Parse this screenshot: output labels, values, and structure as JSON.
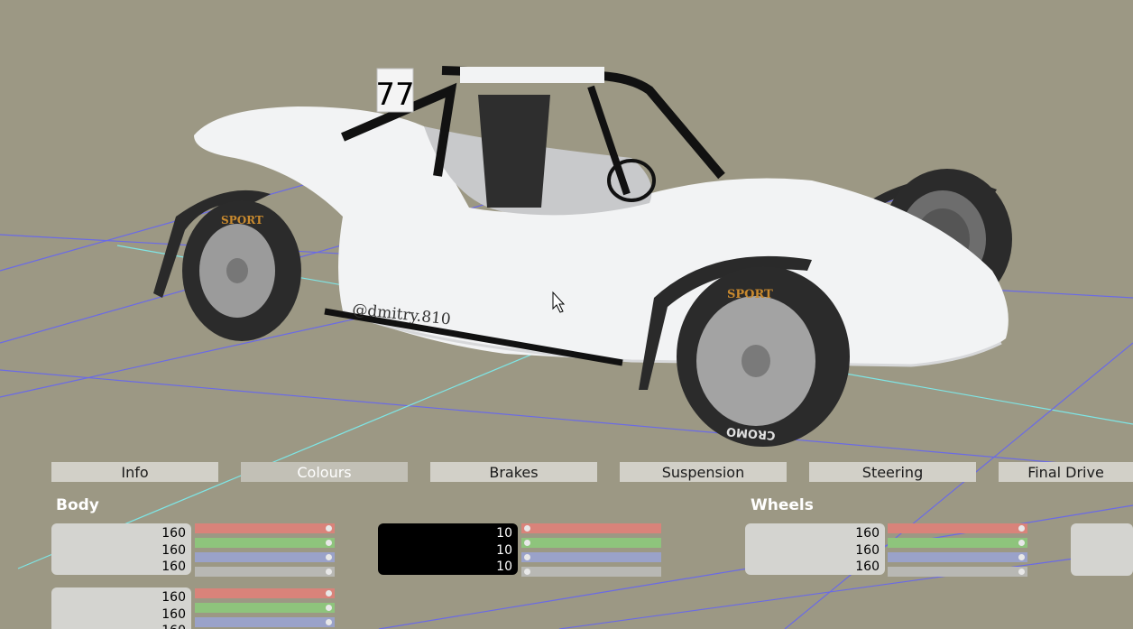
{
  "tabs": [
    {
      "label": "Info"
    },
    {
      "label": "Colours"
    },
    {
      "label": "Brakes"
    },
    {
      "label": "Suspension"
    },
    {
      "label": "Steering"
    },
    {
      "label": "Final Drive"
    }
  ],
  "active_tab": "Colours",
  "car": {
    "number": "77",
    "side_text": "@dmitry.810",
    "tyre_brand": "SPORT",
    "rim_brand": "CROMO"
  },
  "sections": {
    "body": {
      "label": "Body",
      "primary": [
        "160",
        "160",
        "160"
      ],
      "secondary": [
        "10",
        "10",
        "10"
      ],
      "tertiary": [
        "160",
        "160",
        "160"
      ]
    },
    "wheels": {
      "label": "Wheels",
      "primary": [
        "160",
        "160",
        "160"
      ]
    }
  },
  "colors": {
    "background": "#9c9884",
    "car_body": "#f2f3f4",
    "grid_blue": "#6a6ae6",
    "grid_cyan": "#7ee6e6",
    "slider_red": "#d9837a",
    "slider_green": "#8ec47c",
    "slider_blue": "#9aa2c9"
  }
}
